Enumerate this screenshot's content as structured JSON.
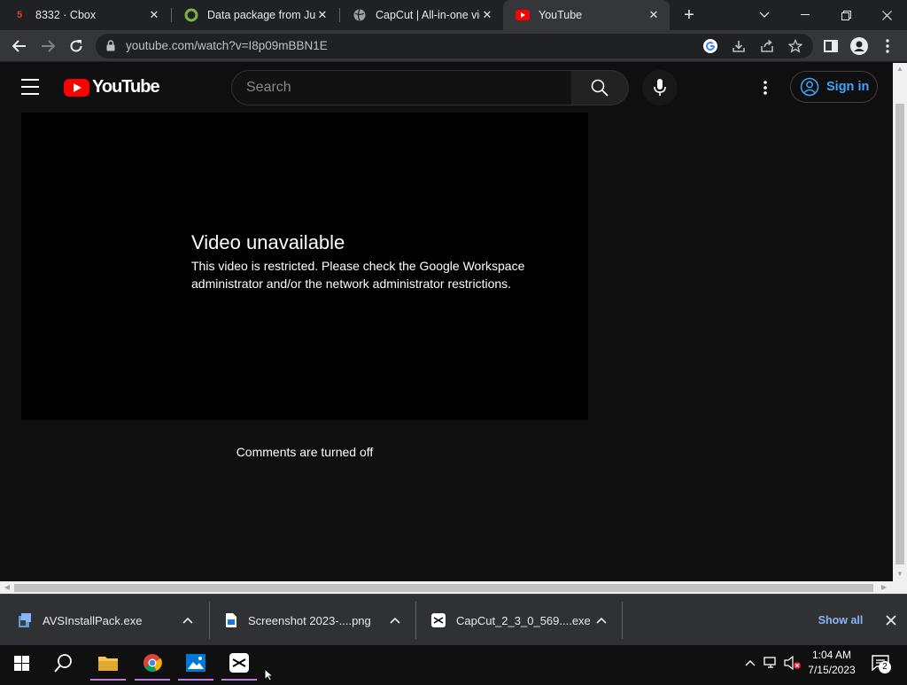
{
  "browser": {
    "tabs": [
      {
        "title": "8332 · Cbox",
        "favicon": "cbox-icon",
        "favicon_badge": "5",
        "active": false
      },
      {
        "title": "Data package from July",
        "favicon": "data-package-icon",
        "active": false
      },
      {
        "title": "CapCut | All-in-one vid",
        "favicon": "globe-icon",
        "active": false
      },
      {
        "title": "YouTube",
        "favicon": "youtube-icon",
        "active": true
      }
    ],
    "url": "youtube.com/watch?v=I8p09mBBN1E"
  },
  "youtube": {
    "logo_text": "YouTube",
    "search_placeholder": "Search",
    "sign_in_label": "Sign in",
    "error_title": "Video unavailable",
    "error_message": "This video is restricted. Please check the Google Workspace administrator and/or the network administrator restrictions.",
    "comments_status": "Comments are turned off"
  },
  "downloads": {
    "items": [
      {
        "name": "AVSInstallPack.exe",
        "icon": "installer-icon"
      },
      {
        "name": "Screenshot 2023-....png",
        "icon": "image-file-icon"
      },
      {
        "name": "CapCut_2_3_0_569....exe",
        "icon": "capcut-icon"
      }
    ],
    "show_all_label": "Show all"
  },
  "taskbar": {
    "time": "1:04 AM",
    "date": "7/15/2023",
    "notification_count": "2"
  },
  "colors": {
    "youtube_red": "#ff0000",
    "link_blue": "#3ea6ff",
    "chrome_bg": "#202124",
    "page_bg": "#0f0f0f"
  }
}
